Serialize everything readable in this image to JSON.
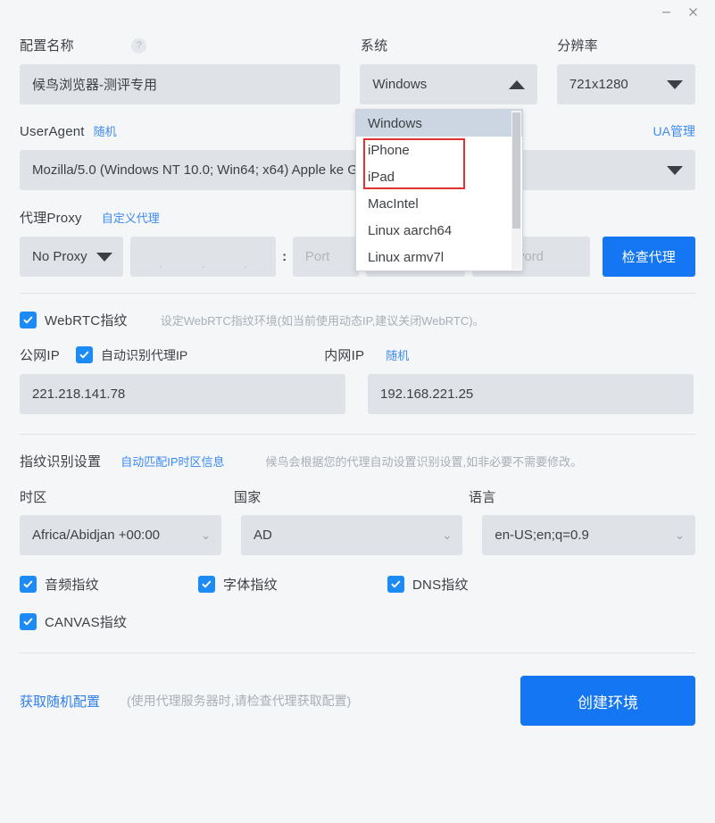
{
  "window": {
    "minimize_label": "—",
    "close_label": "✕"
  },
  "section_profile": {
    "name_label": "配置名称",
    "help_icon": "question-circle-icon",
    "name_value": "候鸟浏览器-测评专用",
    "system_label": "系统",
    "system_value": "Windows",
    "resolution_label": "分辨率",
    "resolution_value": "721x1280"
  },
  "system_dropdown": {
    "open": true,
    "options": [
      "Windows",
      "iPhone",
      "iPad",
      "MacIntel",
      "Linux aarch64",
      "Linux armv7l"
    ],
    "selected": "Windows",
    "highlight_color": "#e03131"
  },
  "section_useragent": {
    "label": "UserAgent",
    "random_link": "随机",
    "manage_link": "UA管理",
    "value": "Mozilla/5.0 (Windows NT 10.0; Win64; x64) Apple                         ke Gecko) Chro..."
  },
  "section_proxy": {
    "label": "代理Proxy",
    "custom_link": "自定义代理",
    "type_value": "No Proxy",
    "ip_placeholder": ".     .     .",
    "separator": ":",
    "port_placeholder": "Port",
    "account_placeholder": "Account",
    "password_placeholder": "Password",
    "check_button": "检查代理"
  },
  "section_webrtc": {
    "checkbox_label": "WebRTC指纹",
    "checked": true,
    "hint": "设定WebRTC指纹环境(如当前使用动态IP,建议关闭WebRTC)。",
    "public_ip_label": "公网IP",
    "auto_detect_label": "自动识别代理IP",
    "auto_detect_checked": true,
    "local_ip_label": "内网IP",
    "random_link": "随机",
    "public_ip_value": "221.218.141.78",
    "local_ip_value": "192.168.221.25"
  },
  "section_fingerprint": {
    "title": "指纹识别设置",
    "auto_match_link": "自动匹配IP时区信息",
    "hint": "候鸟会根据您的代理自动设置识别设置,如非必要不需要修改。",
    "timezone_label": "时区",
    "country_label": "国家",
    "language_label": "语言",
    "timezone_value": "Africa/Abidjan +00:00",
    "country_value": "AD",
    "language_value": "en-US;en;q=0.9",
    "checks": [
      {
        "label": "音频指纹",
        "checked": true
      },
      {
        "label": "字体指纹",
        "checked": true
      },
      {
        "label": "DNS指纹",
        "checked": true
      },
      {
        "label": "CANVAS指纹",
        "checked": true
      }
    ]
  },
  "footer": {
    "random_config_link": "获取随机配置",
    "hint": "(使用代理服务器时,请检查代理获取配置)",
    "create_button": "创建环境"
  },
  "colors": {
    "accent_blue": "#1476f2",
    "link_blue": "#3d8bf2",
    "field_bg": "#dfe3e8",
    "page_bg": "#f4f6f8",
    "highlight_red": "#e03131"
  }
}
